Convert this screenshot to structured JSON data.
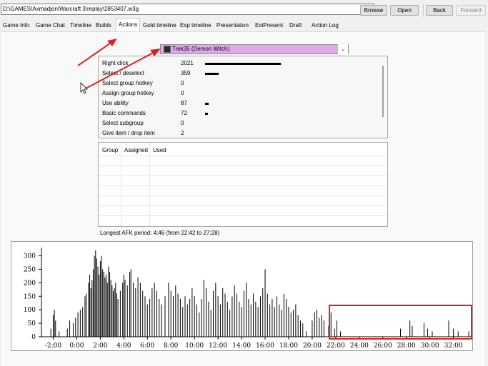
{
  "toolbar": {
    "path": "D:\\GAMES\\Axmadjon\\Warcraft 3\\replay\\2853407.w3g",
    "browse": "Browse",
    "open": "Open",
    "back": "Back",
    "forward": "Forward"
  },
  "tabs": [
    {
      "label": "Game Info"
    },
    {
      "label": "Game Chat"
    },
    {
      "label": "Timeline"
    },
    {
      "label": "Builds"
    },
    {
      "label": "Actions",
      "active": true
    },
    {
      "label": "Gold timeline"
    },
    {
      "label": "Exp timeline"
    },
    {
      "label": "Presentation"
    },
    {
      "label": "ExtPresent"
    },
    {
      "label": "Draft"
    },
    {
      "label": "Action Log"
    }
  ],
  "player_select": {
    "value": "Trek35 (Demon Witch)",
    "color": "#e2a6ec"
  },
  "actions": [
    {
      "label": "Right click",
      "value": "2021"
    },
    {
      "label": "Select / deselect",
      "value": "359"
    },
    {
      "label": "Select group hotkey",
      "value": "0"
    },
    {
      "label": "Assign group hotkey",
      "value": "0"
    },
    {
      "label": "Use ability",
      "value": "87"
    },
    {
      "label": "Basic commands",
      "value": "72"
    },
    {
      "label": "Select subgroup",
      "value": "0"
    },
    {
      "label": "Give item / drop item",
      "value": "2"
    }
  ],
  "groups": {
    "columns": [
      "Group",
      "Assigned",
      "Used"
    ]
  },
  "afk_text": "Longest AFK period: 4:46 (from 22:42 to 27:28)",
  "annotation_color": "#e02020",
  "chart_data": {
    "type": "bar",
    "ylim": [
      0,
      320
    ],
    "y_ticks": [
      "0",
      "50",
      "100",
      "150",
      "200",
      "250",
      "300"
    ],
    "x_ticks": [
      "-2:00",
      "0:00",
      "2:00",
      "4:00",
      "6:00",
      "8:00",
      "10:00",
      "12:00",
      "14:00",
      "16:00",
      "18:00",
      "20:00",
      "22:00",
      "24:00",
      "26:00",
      "28:00",
      "30:00",
      "32:00"
    ],
    "x_range_minutes": [
      -3,
      33.6
    ],
    "bar_width_minutes": 0.1,
    "values": [
      {
        "t": -2.2,
        "v": 30
      },
      {
        "t": -2.0,
        "v": 80
      },
      {
        "t": -1.9,
        "v": 100
      },
      {
        "t": -1.8,
        "v": 60
      },
      {
        "t": -1.5,
        "v": 20
      },
      {
        "t": -0.8,
        "v": 30
      },
      {
        "t": -0.6,
        "v": 60
      },
      {
        "t": -0.3,
        "v": 50
      },
      {
        "t": -0.1,
        "v": 70
      },
      {
        "t": 0.1,
        "v": 90
      },
      {
        "t": 0.3,
        "v": 100
      },
      {
        "t": 0.5,
        "v": 110
      },
      {
        "t": 0.7,
        "v": 150
      },
      {
        "t": 0.8,
        "v": 160
      },
      {
        "t": 1.0,
        "v": 200
      },
      {
        "t": 1.1,
        "v": 230
      },
      {
        "t": 1.2,
        "v": 180
      },
      {
        "t": 1.3,
        "v": 210
      },
      {
        "t": 1.4,
        "v": 250
      },
      {
        "t": 1.5,
        "v": 300
      },
      {
        "t": 1.6,
        "v": 320
      },
      {
        "t": 1.7,
        "v": 290
      },
      {
        "t": 1.8,
        "v": 260
      },
      {
        "t": 1.9,
        "v": 230
      },
      {
        "t": 2.0,
        "v": 280
      },
      {
        "t": 2.1,
        "v": 300
      },
      {
        "t": 2.2,
        "v": 250
      },
      {
        "t": 2.3,
        "v": 240
      },
      {
        "t": 2.4,
        "v": 220
      },
      {
        "t": 2.5,
        "v": 230
      },
      {
        "t": 2.6,
        "v": 200
      },
      {
        "t": 2.7,
        "v": 260
      },
      {
        "t": 2.8,
        "v": 240
      },
      {
        "t": 2.9,
        "v": 210
      },
      {
        "t": 3.0,
        "v": 190
      },
      {
        "t": 3.1,
        "v": 170
      },
      {
        "t": 3.2,
        "v": 180
      },
      {
        "t": 3.3,
        "v": 200
      },
      {
        "t": 3.4,
        "v": 160
      },
      {
        "t": 3.5,
        "v": 140
      },
      {
        "t": 3.7,
        "v": 170
      },
      {
        "t": 3.9,
        "v": 200
      },
      {
        "t": 4.0,
        "v": 230
      },
      {
        "t": 4.1,
        "v": 210
      },
      {
        "t": 4.3,
        "v": 190
      },
      {
        "t": 4.5,
        "v": 240
      },
      {
        "t": 4.6,
        "v": 250
      },
      {
        "t": 4.8,
        "v": 200
      },
      {
        "t": 5.0,
        "v": 180
      },
      {
        "t": 5.2,
        "v": 220
      },
      {
        "t": 5.4,
        "v": 200
      },
      {
        "t": 5.6,
        "v": 170
      },
      {
        "t": 5.8,
        "v": 150
      },
      {
        "t": 6.0,
        "v": 120
      },
      {
        "t": 6.2,
        "v": 140
      },
      {
        "t": 6.4,
        "v": 180
      },
      {
        "t": 6.6,
        "v": 200
      },
      {
        "t": 6.8,
        "v": 170
      },
      {
        "t": 7.0,
        "v": 140
      },
      {
        "t": 7.2,
        "v": 120
      },
      {
        "t": 7.5,
        "v": 150
      },
      {
        "t": 7.8,
        "v": 200
      },
      {
        "t": 8.0,
        "v": 170
      },
      {
        "t": 8.2,
        "v": 150
      },
      {
        "t": 8.4,
        "v": 190
      },
      {
        "t": 8.6,
        "v": 160
      },
      {
        "t": 8.8,
        "v": 140
      },
      {
        "t": 9.0,
        "v": 110
      },
      {
        "t": 9.2,
        "v": 150
      },
      {
        "t": 9.4,
        "v": 120
      },
      {
        "t": 9.6,
        "v": 140
      },
      {
        "t": 9.8,
        "v": 180
      },
      {
        "t": 10.0,
        "v": 150
      },
      {
        "t": 10.2,
        "v": 120
      },
      {
        "t": 10.4,
        "v": 90
      },
      {
        "t": 10.6,
        "v": 140
      },
      {
        "t": 10.8,
        "v": 210
      },
      {
        "t": 11.0,
        "v": 180
      },
      {
        "t": 11.2,
        "v": 130
      },
      {
        "t": 11.4,
        "v": 100
      },
      {
        "t": 11.6,
        "v": 170
      },
      {
        "t": 11.8,
        "v": 200
      },
      {
        "t": 12.0,
        "v": 150
      },
      {
        "t": 12.2,
        "v": 120
      },
      {
        "t": 12.4,
        "v": 180
      },
      {
        "t": 12.6,
        "v": 160
      },
      {
        "t": 12.8,
        "v": 130
      },
      {
        "t": 13.0,
        "v": 100
      },
      {
        "t": 13.2,
        "v": 150
      },
      {
        "t": 13.4,
        "v": 190
      },
      {
        "t": 13.6,
        "v": 160
      },
      {
        "t": 13.8,
        "v": 130
      },
      {
        "t": 14.0,
        "v": 110
      },
      {
        "t": 14.2,
        "v": 170
      },
      {
        "t": 14.4,
        "v": 200
      },
      {
        "t": 14.6,
        "v": 140
      },
      {
        "t": 14.8,
        "v": 120
      },
      {
        "t": 15.0,
        "v": 160
      },
      {
        "t": 15.2,
        "v": 130
      },
      {
        "t": 15.4,
        "v": 110
      },
      {
        "t": 15.6,
        "v": 150
      },
      {
        "t": 15.8,
        "v": 180
      },
      {
        "t": 16.0,
        "v": 250
      },
      {
        "t": 16.2,
        "v": 160
      },
      {
        "t": 16.4,
        "v": 120
      },
      {
        "t": 16.6,
        "v": 140
      },
      {
        "t": 16.8,
        "v": 110
      },
      {
        "t": 17.0,
        "v": 150
      },
      {
        "t": 17.2,
        "v": 120
      },
      {
        "t": 17.4,
        "v": 100
      },
      {
        "t": 17.6,
        "v": 160
      },
      {
        "t": 17.8,
        "v": 140
      },
      {
        "t": 18.0,
        "v": 110
      },
      {
        "t": 18.2,
        "v": 90
      },
      {
        "t": 18.4,
        "v": 100
      },
      {
        "t": 18.6,
        "v": 120
      },
      {
        "t": 18.8,
        "v": 80
      },
      {
        "t": 19.0,
        "v": 60
      },
      {
        "t": 19.2,
        "v": 50
      },
      {
        "t": 19.5,
        "v": 20
      },
      {
        "t": 20.0,
        "v": 60
      },
      {
        "t": 20.2,
        "v": 90
      },
      {
        "t": 20.4,
        "v": 100
      },
      {
        "t": 20.6,
        "v": 70
      },
      {
        "t": 20.8,
        "v": 80
      },
      {
        "t": 21.0,
        "v": 60
      },
      {
        "t": 21.4,
        "v": 40
      },
      {
        "t": 21.6,
        "v": 90
      },
      {
        "t": 21.9,
        "v": 30
      },
      {
        "t": 22.1,
        "v": 60
      },
      {
        "t": 22.4,
        "v": 20
      },
      {
        "t": 27.5,
        "v": 30
      },
      {
        "t": 28.3,
        "v": 60
      },
      {
        "t": 28.5,
        "v": 40
      },
      {
        "t": 29.5,
        "v": 50
      },
      {
        "t": 29.8,
        "v": 30
      },
      {
        "t": 30.2,
        "v": 20
      },
      {
        "t": 31.6,
        "v": 60
      },
      {
        "t": 32.0,
        "v": 30
      },
      {
        "t": 32.4,
        "v": 20
      },
      {
        "t": 33.3,
        "v": 20
      }
    ]
  }
}
